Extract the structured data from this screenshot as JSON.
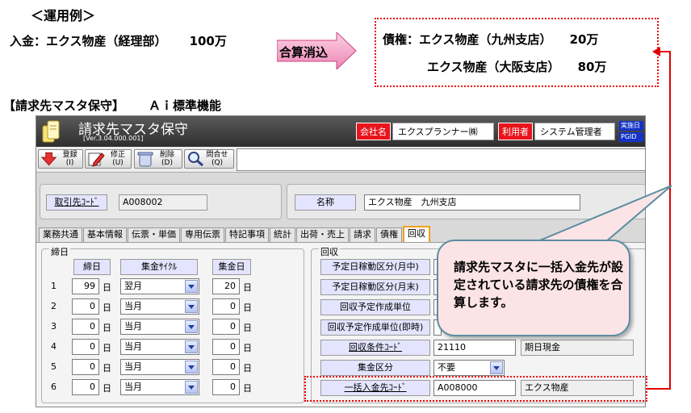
{
  "example": {
    "title": "＜運用例＞",
    "left_label": "入金：エクス物産（経理部）",
    "left_amount": "100万",
    "arrow_label": "合算消込",
    "right_rows": [
      {
        "label": "債権：エクス物産（九州支店）",
        "amount": "20万"
      },
      {
        "label": "エクス物産（大阪支店）",
        "amount": "80万"
      }
    ]
  },
  "section": {
    "heading": "【請求先マスタ保守】",
    "standard": "Ａｉ標準機能"
  },
  "window": {
    "title": "請求先マスタ保守",
    "version": "[Ver.3.04.000.001]",
    "company_label": "会社名",
    "company_value": "エクスプランナー㈱",
    "user_label": "利用者",
    "user_value": "システム管理者",
    "badge1": "実施日",
    "badge2": "PGID"
  },
  "toolbar": {
    "buttons": [
      {
        "label": "登録",
        "key": "(I)"
      },
      {
        "label": "修正",
        "key": "(U)"
      },
      {
        "label": "削除",
        "key": "(D)"
      },
      {
        "label": "問合せ",
        "key": "(Q)"
      }
    ]
  },
  "header": {
    "code_label": "取引先ｺｰﾄﾞ",
    "code_value": "A008002",
    "name_label": "名称",
    "name_value": "エクス物産　九州支店"
  },
  "tabs": [
    "業務共通",
    "基本情報",
    "伝票・単価",
    "専用伝票",
    "特記事項",
    "統計",
    "出荷・売上",
    "請求",
    "債権",
    "回収"
  ],
  "active_tab_index": 9,
  "closing": {
    "group_title": "締日",
    "col_day": "締日",
    "col_cycle": "集金ｻｲｸﾙ",
    "col_collect": "集金日",
    "unit_day": "日",
    "rows": [
      {
        "no": "1",
        "day": "99",
        "cycle": "翌月",
        "collect": "20"
      },
      {
        "no": "2",
        "day": "0",
        "cycle": "当月",
        "collect": "0"
      },
      {
        "no": "3",
        "day": "0",
        "cycle": "当月",
        "collect": "0"
      },
      {
        "no": "4",
        "day": "0",
        "cycle": "当月",
        "collect": "0"
      },
      {
        "no": "5",
        "day": "0",
        "cycle": "当月",
        "collect": "0"
      },
      {
        "no": "6",
        "day": "0",
        "cycle": "当月",
        "collect": "0"
      }
    ]
  },
  "collection": {
    "group_title": "回収",
    "fields": [
      {
        "label": "予定日稼動区分(月中)",
        "value": ""
      },
      {
        "label": "予定日稼動区分(月末)",
        "value": ""
      },
      {
        "label": "回収予定作成単位",
        "value": ""
      },
      {
        "label": "回収予定作成単位(即時)",
        "value": ""
      }
    ],
    "terms_label": "回収条件ｺｰﾄﾞ",
    "terms_code": "21110",
    "terms_name": "期日現金",
    "collect_type_label": "集金区分",
    "collect_type_value": "不要",
    "bulk_label": "一括入金先ｺｰﾄﾞ",
    "bulk_code": "A008000",
    "bulk_name": "エクス物産"
  },
  "callout": {
    "text": "請求先マスタに一括入金先が設定されている請求先の債権を合算します。"
  },
  "colors": {
    "accent_red": "#e00000",
    "arrow_fill": "#f3a6c8",
    "bubble_fill": "#fce4e6",
    "title_bar": "#3a3a3a"
  }
}
